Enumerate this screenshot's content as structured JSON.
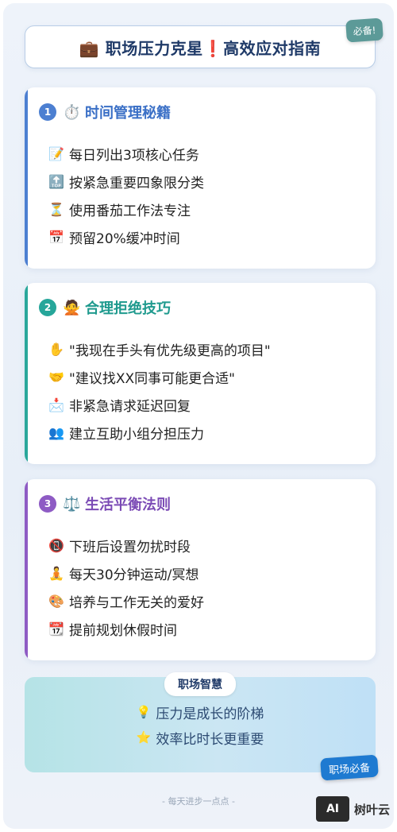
{
  "header": {
    "title": "💼 职场压力克星❗高效应对指南",
    "tag": "必备!"
  },
  "sections": [
    {
      "num": "1",
      "icon": "⏱️",
      "title": "时间管理秘籍",
      "items": [
        {
          "icon": "📝",
          "text": "每日列出3项核心任务"
        },
        {
          "icon": "🔝",
          "text": "按紧急重要四象限分类"
        },
        {
          "icon": "⏳",
          "text": "使用番茄工作法专注"
        },
        {
          "icon": "📅",
          "text": "预留20%缓冲时间"
        }
      ]
    },
    {
      "num": "2",
      "icon": "🙅",
      "title": "合理拒绝技巧",
      "items": [
        {
          "icon": "✋",
          "text": "\"我现在手头有优先级更高的项目\""
        },
        {
          "icon": "🤝",
          "text": "\"建议找XX同事可能更合适\""
        },
        {
          "icon": "📩",
          "text": "非紧急请求延迟回复"
        },
        {
          "icon": "👥",
          "text": "建立互助小组分担压力"
        }
      ]
    },
    {
      "num": "3",
      "icon": "⚖️",
      "title": "生活平衡法则",
      "items": [
        {
          "icon": "📵",
          "text": "下班后设置勿扰时段"
        },
        {
          "icon": "🧘",
          "text": "每天30分钟运动/冥想"
        },
        {
          "icon": "🎨",
          "text": "培养与工作无关的爱好"
        },
        {
          "icon": "📆",
          "text": "提前规划休假时间"
        }
      ]
    }
  ],
  "summary": {
    "title": "职场智慧",
    "items": [
      {
        "icon": "💡",
        "text": "压力是成长的阶梯"
      },
      {
        "icon": "⭐",
        "text": "效率比时长更重要"
      }
    ],
    "tag": "职场必备"
  },
  "footer": "- 每天进步一点点 -",
  "watermark": {
    "logo": "AI",
    "text": "树叶云"
  }
}
